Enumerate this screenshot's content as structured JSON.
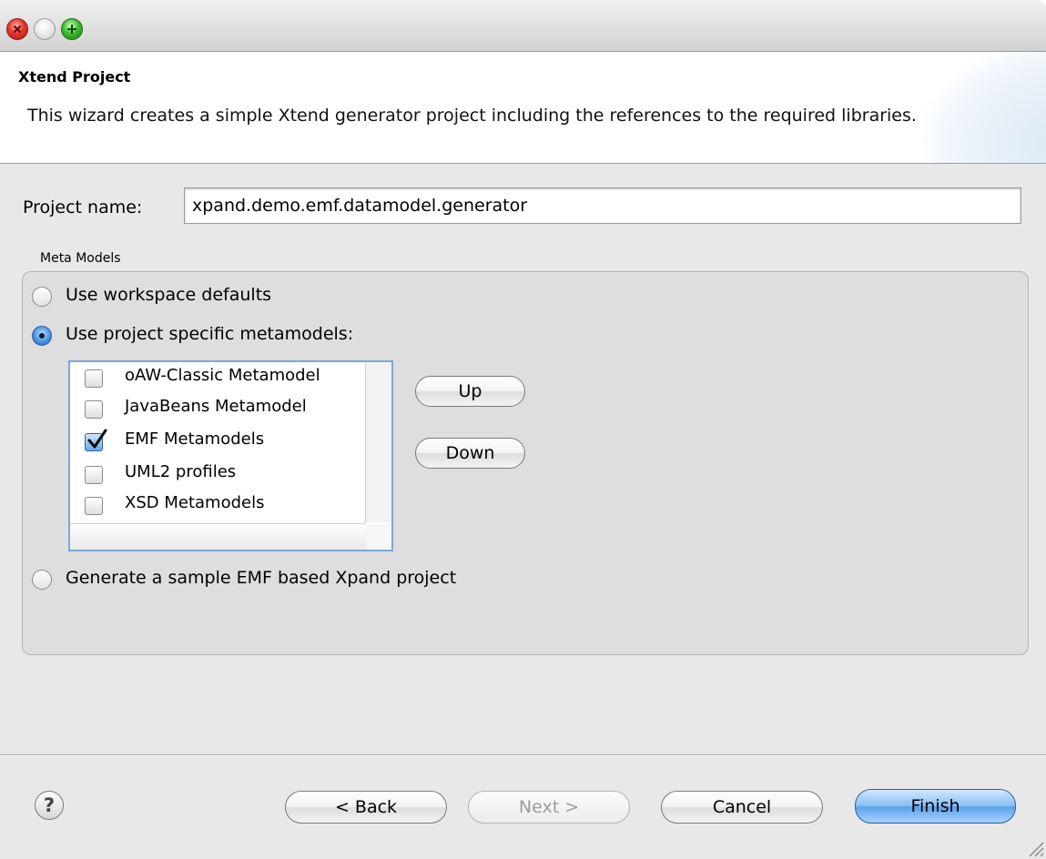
{
  "window": {
    "controls": [
      "close-icon",
      "minimize-icon",
      "zoom-icon"
    ]
  },
  "header": {
    "title": "Xtend Project",
    "description": "This wizard creates a simple Xtend generator project including the references to the required libraries."
  },
  "form": {
    "project_name_label": "Project name:",
    "project_name_value": "xpand.demo.emf.datamodel.generator",
    "meta_models_group_label": "Meta Models",
    "options": {
      "workspace_defaults": {
        "label": "Use workspace defaults",
        "selected": false
      },
      "project_specific": {
        "label": "Use project specific metamodels:",
        "selected": true
      },
      "sample_project": {
        "label": "Generate a sample EMF based Xpand project",
        "selected": false
      }
    },
    "metamodels": [
      {
        "label": "oAW-Classic Metamodel",
        "checked": false
      },
      {
        "label": "JavaBeans Metamodel",
        "checked": false
      },
      {
        "label": "EMF Metamodels",
        "checked": true
      },
      {
        "label": "UML2 profiles",
        "checked": false
      },
      {
        "label": "XSD Metamodels",
        "checked": false
      }
    ],
    "up_label": "Up",
    "down_label": "Down"
  },
  "footer": {
    "help_glyph": "?",
    "back_label": "< Back",
    "next_label": "Next >",
    "cancel_label": "Cancel",
    "finish_label": "Finish"
  },
  "colors": {
    "accent": "#5aa0ea",
    "window_bg": "#e8e8e8"
  }
}
